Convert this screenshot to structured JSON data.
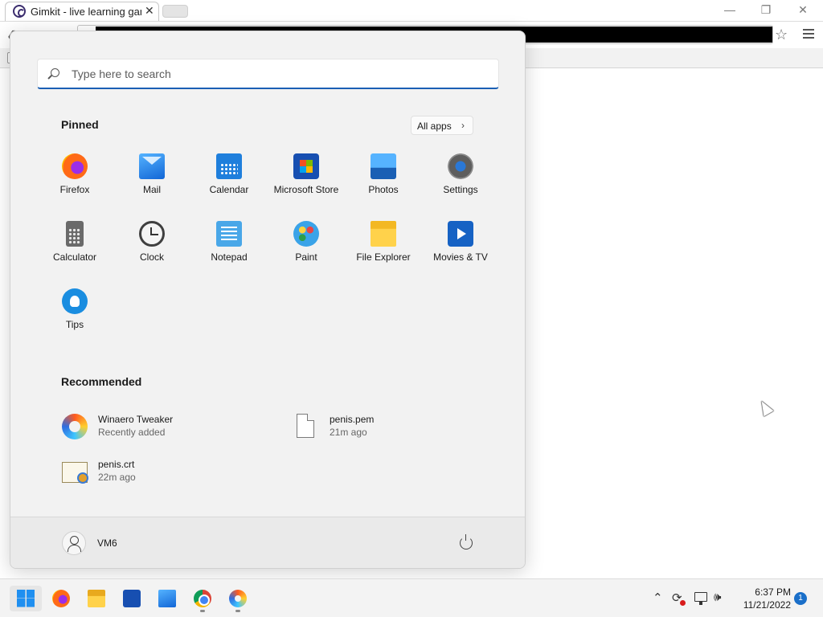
{
  "browser": {
    "tab_title": "Gimkit - live learning game",
    "tab_close": "✕",
    "window_min": "—",
    "window_restore": "❐",
    "window_close": "✕",
    "back_icon": "❮",
    "reload_icon": "↻",
    "lock_icon": "ⓘ",
    "star_icon": "☆"
  },
  "start_menu": {
    "search_placeholder": "Type here to search",
    "pinned_title": "Pinned",
    "all_apps_label": "All apps",
    "all_apps_chevron": "›",
    "pinned": [
      {
        "label": "Firefox",
        "icon": "firefox-icon"
      },
      {
        "label": "Mail",
        "icon": "mail-icon"
      },
      {
        "label": "Calendar",
        "icon": "calendar-icon"
      },
      {
        "label": "Microsoft Store",
        "icon": "store-icon"
      },
      {
        "label": "Photos",
        "icon": "photos-icon"
      },
      {
        "label": "Settings",
        "icon": "settings-icon"
      },
      {
        "label": "Calculator",
        "icon": "calculator-icon"
      },
      {
        "label": "Clock",
        "icon": "clock-icon"
      },
      {
        "label": "Notepad",
        "icon": "notepad-icon"
      },
      {
        "label": "Paint",
        "icon": "paint-icon"
      },
      {
        "label": "File Explorer",
        "icon": "file-explorer-icon"
      },
      {
        "label": "Movies & TV",
        "icon": "movies-icon"
      },
      {
        "label": "Tips",
        "icon": "tips-icon"
      }
    ],
    "recommended_title": "Recommended",
    "recommended": [
      {
        "name": "Winaero Tweaker",
        "sub": "Recently added",
        "icon": "winaero-icon"
      },
      {
        "name": "penis.pem",
        "sub": "21m ago",
        "icon": "file-icon"
      },
      {
        "name": "penis.crt",
        "sub": "22m ago",
        "icon": "certificate-icon"
      }
    ],
    "user_name": "VM6"
  },
  "taskbar": {
    "apps": [
      "start-icon",
      "firefox-icon",
      "file-explorer-icon",
      "store-icon",
      "mail-icon",
      "chrome-icon",
      "winaero-icon"
    ],
    "tray_chevron": "⌃",
    "tray_sync": "⟳",
    "tray_volume": "🕪",
    "time": "6:37 PM",
    "date": "11/21/2022",
    "notification_count": "1"
  },
  "colors": {
    "accent": "#1a5fb4",
    "start_menu_bg": "#f2f2f2",
    "taskbar_bg": "#f3f3f3"
  }
}
